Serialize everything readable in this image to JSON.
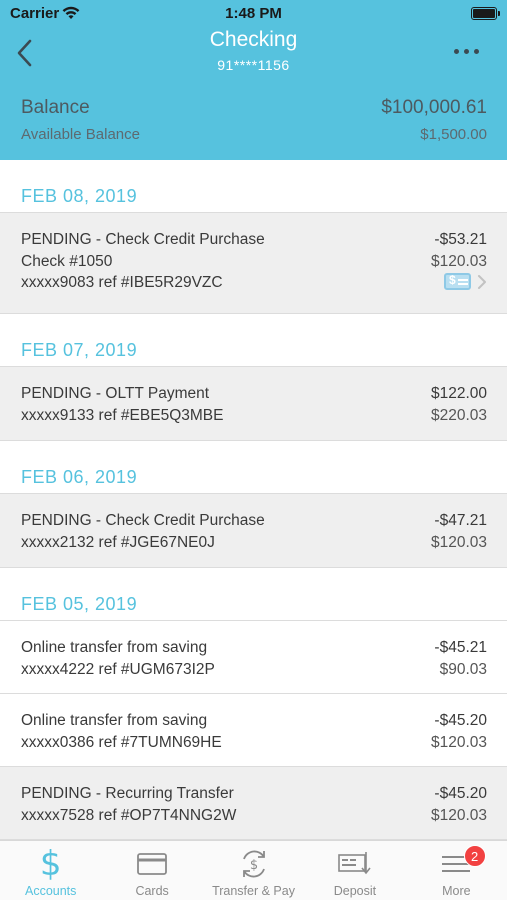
{
  "status_bar": {
    "carrier": "Carrier",
    "time": "1:48 PM"
  },
  "header": {
    "title": "Checking",
    "account_number": "91****1156",
    "balance_label": "Balance",
    "balance_value": "$100,000.61",
    "available_label": "Available Balance",
    "available_value": "$1,500.00"
  },
  "groups": [
    {
      "date": "FEB 08, 2019",
      "transactions": [
        {
          "description": "PENDING - Check Credit Purchase",
          "amount": "-$53.21",
          "line2": "Check #1050",
          "line2_amount": "$120.03",
          "line3": "xxxxx9083 ref #IBE5R29VZC"
        }
      ]
    },
    {
      "date": "FEB 07, 2019",
      "transactions": [
        {
          "description": "PENDING - OLTT Payment",
          "amount": "$122.00",
          "line2": "xxxxx9133 ref #EBE5Q3MBE",
          "line2_amount": "$220.03"
        }
      ]
    },
    {
      "date": "FEB 06, 2019",
      "transactions": [
        {
          "description": "PENDING - Check Credit Purchase",
          "amount": "-$47.21",
          "line2": "xxxxx2132 ref #JGE67NE0J",
          "line2_amount": "$120.03"
        }
      ]
    },
    {
      "date": "FEB 05, 2019",
      "transactions": [
        {
          "description": "Online transfer from saving",
          "amount": "-$45.21",
          "line2": "xxxxx4222 ref #UGM673I2P",
          "line2_amount": "$90.03"
        },
        {
          "description": "Online transfer from saving",
          "amount": "-$45.20",
          "line2": "xxxxx0386 ref #7TUMN69HE",
          "line2_amount": "$120.03"
        },
        {
          "description": "PENDING - Recurring Transfer",
          "amount": "-$45.20",
          "line2": "xxxxx7528 ref #OP7T4NNG2W",
          "line2_amount": "$120.03"
        }
      ]
    }
  ],
  "tabbar": {
    "accounts": "Accounts",
    "cards": "Cards",
    "transfer": "Transfer & Pay",
    "deposit": "Deposit",
    "more": "More",
    "more_badge": "2"
  },
  "colors": {
    "accent": "#56c2de",
    "badge": "#f24141",
    "pending_bg": "#efefef"
  }
}
